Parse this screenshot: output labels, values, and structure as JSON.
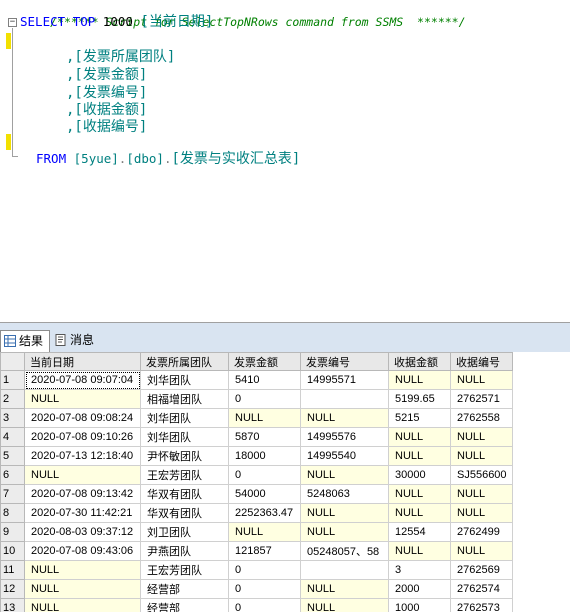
{
  "editor": {
    "comment": "/****** Script for SelectTopNRows command from SSMS  ******/",
    "select_kw": "SELECT",
    "top_kw": "TOP",
    "top_n": "1000",
    "columns": [
      "[当前日期]",
      ",[发票所属团队]",
      ",[发票金额]",
      ",[发票编号]",
      ",[收据金额]",
      ",[收据编号]"
    ],
    "from_kw": "FROM",
    "db": "[5yue]",
    "schema": "[dbo]",
    "table": "[发票与实收汇总表]",
    "dot": "."
  },
  "results": {
    "tabs": [
      {
        "label": "结果",
        "icon": "grid-icon"
      },
      {
        "label": "消息",
        "icon": "message-icon"
      }
    ],
    "headers": [
      "当前日期",
      "发票所属团队",
      "发票金额",
      "发票编号",
      "收据金额",
      "收据编号"
    ],
    "rows": [
      [
        "1",
        "2020-07-08 09:07:04",
        "刘华团队",
        "5410",
        "14995571",
        "NULL",
        "NULL"
      ],
      [
        "2",
        "NULL",
        "相福增团队",
        "0",
        "",
        "5199.65",
        "2762571"
      ],
      [
        "3",
        "2020-07-08 09:08:24",
        "刘华团队",
        "NULL",
        "NULL",
        "5215",
        "2762558"
      ],
      [
        "4",
        "2020-07-08 09:10:26",
        "刘华团队",
        "5870",
        "14995576",
        "NULL",
        "NULL"
      ],
      [
        "5",
        "2020-07-13 12:18:40",
        "尹怀敏团队",
        "18000",
        "14995540",
        "NULL",
        "NULL"
      ],
      [
        "6",
        "NULL",
        "王宏芳团队",
        "0",
        "NULL",
        "30000",
        "SJ556600"
      ],
      [
        "7",
        "2020-07-08 09:13:42",
        "华双有团队",
        "54000",
        "5248063",
        "NULL",
        "NULL"
      ],
      [
        "8",
        "2020-07-30 11:42:21",
        "华双有团队",
        "2252363.47",
        "NULL",
        "NULL",
        "NULL"
      ],
      [
        "9",
        "2020-08-03 09:37:12",
        "刘卫团队",
        "NULL",
        "NULL",
        "12554",
        "2762499"
      ],
      [
        "10",
        "2020-07-08 09:43:06",
        "尹燕团队",
        "121857",
        "05248057、58",
        "NULL",
        "NULL"
      ],
      [
        "11",
        "NULL",
        "王宏芳团队",
        "0",
        "",
        "3",
        "2762569"
      ],
      [
        "12",
        "NULL",
        "经营部",
        "0",
        "NULL",
        "2000",
        "2762574"
      ],
      [
        "13",
        "NULL",
        "经营部",
        "0",
        "NULL",
        "1000",
        "2762573"
      ]
    ]
  }
}
